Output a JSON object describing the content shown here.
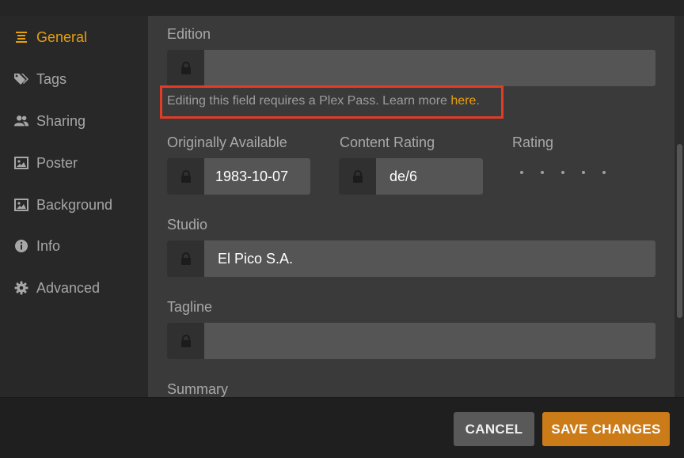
{
  "sidebar": {
    "items": [
      {
        "label": "General",
        "icon": "list-icon",
        "active": true
      },
      {
        "label": "Tags",
        "icon": "tags-icon"
      },
      {
        "label": "Sharing",
        "icon": "users-icon"
      },
      {
        "label": "Poster",
        "icon": "image-icon"
      },
      {
        "label": "Background",
        "icon": "image-icon"
      },
      {
        "label": "Info",
        "icon": "info-icon"
      },
      {
        "label": "Advanced",
        "icon": "gear-icon"
      }
    ]
  },
  "form": {
    "edition": {
      "label": "Edition",
      "value": ""
    },
    "notice": {
      "text": "Editing this field requires a Plex Pass. Learn more ",
      "link": "here",
      "suffix": "."
    },
    "originally_available": {
      "label": "Originally Available",
      "value": "1983-10-07"
    },
    "content_rating": {
      "label": "Content Rating",
      "value": "de/6"
    },
    "rating": {
      "label": "Rating",
      "stars": 0,
      "max": 5
    },
    "studio": {
      "label": "Studio",
      "value": "El Pico S.A."
    },
    "tagline": {
      "label": "Tagline",
      "value": ""
    },
    "summary": {
      "label": "Summary"
    }
  },
  "footer": {
    "cancel_label": "CANCEL",
    "save_label": "SAVE CHANGES"
  },
  "colors": {
    "accent": "#e5a00d",
    "save_button": "#cc7b19",
    "highlight_box": "#e23b26"
  }
}
